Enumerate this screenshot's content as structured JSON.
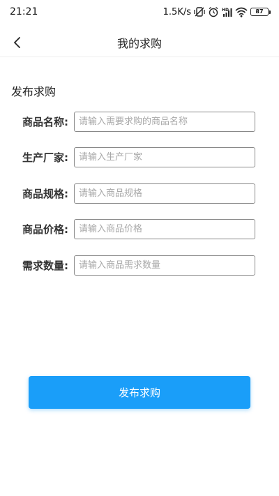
{
  "status_bar": {
    "time": "21:21",
    "network_speed": "1.5K/s",
    "battery_level": "87",
    "icons": [
      "muted-vibrate-icon",
      "alarm-icon",
      "hd-signal-icon",
      "wifi-icon",
      "battery-icon"
    ]
  },
  "nav": {
    "title": "我的求购",
    "back_icon": "chevron-left-icon"
  },
  "form": {
    "section_title": "发布求购",
    "fields": [
      {
        "label": "商品名称:",
        "placeholder": "请输入需要求购的商品名称",
        "value": ""
      },
      {
        "label": "生产厂家:",
        "placeholder": "请输入生产厂家",
        "value": ""
      },
      {
        "label": "商品规格:",
        "placeholder": "请输入商品规格",
        "value": ""
      },
      {
        "label": "商品价格:",
        "placeholder": "请输入商品价格",
        "value": ""
      },
      {
        "label": "需求数量:",
        "placeholder": "请输入商品需求数量",
        "value": ""
      }
    ],
    "submit_label": "发布求购"
  },
  "colors": {
    "primary": "#1a9ef9",
    "border": "#888888",
    "placeholder": "#a8a8a8"
  }
}
